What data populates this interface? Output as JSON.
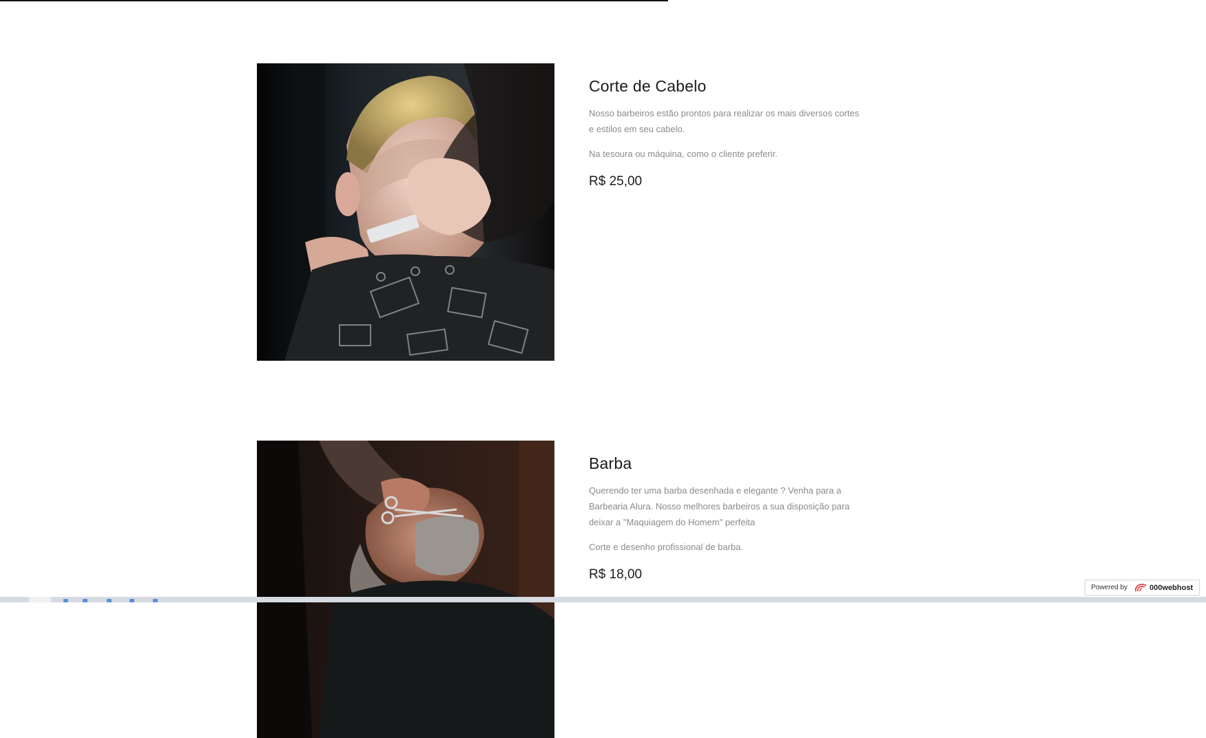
{
  "services": [
    {
      "title": "Corte de Cabelo",
      "image_alt": "Barbeiro cortando cabelo de cliente",
      "paragraphs": [
        "Nosso barbeiros estão prontos para realizar os mais diversos cortes e estilos em seu cabelo.",
        "Na tesoura ou máquina, como o cliente preferir."
      ],
      "price": "R$ 25,00"
    },
    {
      "title": "Barba",
      "image_alt": "Barbeiro aparando barba de cliente",
      "paragraphs": [
        "Querendo ter uma barba desenhada e elegante ? Venha para a Barbearia Alura. Nosso melhores barbeiros a sua disposição para deixar a \"Maquiagem do Homem\" perfeita",
        "Corte e desenho profissional de barba."
      ],
      "price": "R$ 18,00"
    }
  ],
  "badge": {
    "powered_label": "Powered by",
    "brand": "000webhost",
    "icon": "000webhost-logo-icon"
  },
  "colors": {
    "title": "#1b1b1b",
    "text": "#8a8a8a",
    "badge_accent": "#e2262a"
  }
}
